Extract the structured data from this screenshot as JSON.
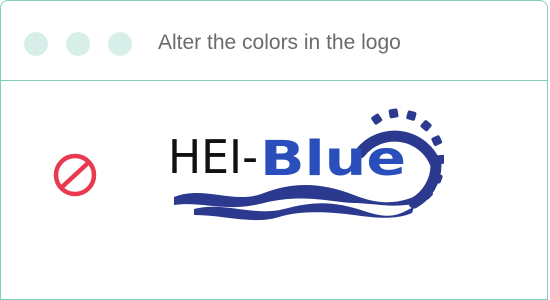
{
  "header": {
    "title": "Alter the colors in the logo"
  },
  "main": {
    "indicator_icon": "prohibited-icon",
    "logo": {
      "text_black": "HEI-",
      "text_blue": "Blue"
    }
  },
  "colors": {
    "border": "#7fcfbf",
    "dot": "#d8efe9",
    "prohibited": "#e8394f",
    "logo_blue": "#2a4fbd",
    "logo_navy": "#2b3a8f",
    "logo_black": "#111111"
  }
}
